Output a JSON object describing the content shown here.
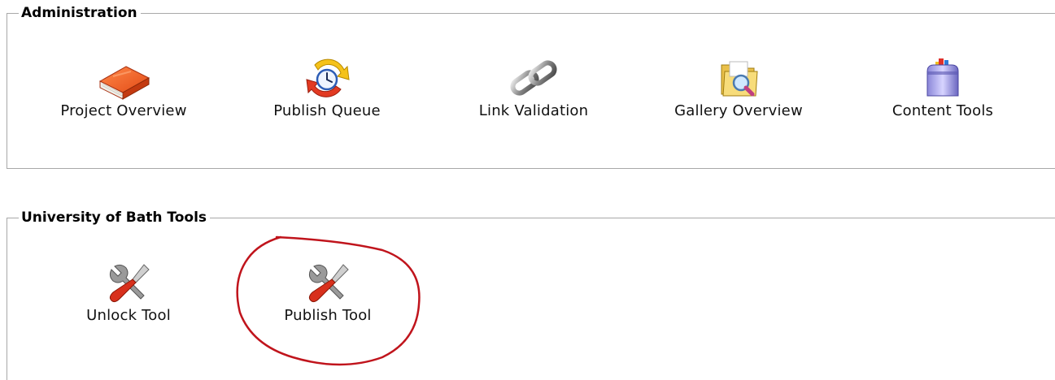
{
  "administration": {
    "legend": "Administration",
    "items": [
      {
        "label": "Project Overview",
        "icon": "book-icon"
      },
      {
        "label": "Publish Queue",
        "icon": "clock-refresh-icon"
      },
      {
        "label": "Link Validation",
        "icon": "chain-link-icon"
      },
      {
        "label": "Gallery Overview",
        "icon": "folder-magnifier-icon"
      },
      {
        "label": "Content Tools",
        "icon": "toolbox-icon"
      }
    ]
  },
  "bath_tools": {
    "legend": "University of Bath Tools",
    "items": [
      {
        "label": "Unlock Tool",
        "icon": "wrench-screwdriver-icon"
      },
      {
        "label": "Publish Tool",
        "icon": "wrench-screwdriver-icon"
      }
    ]
  },
  "annotation": {
    "color": "#c0141c",
    "circled_item": "Publish Tool"
  }
}
